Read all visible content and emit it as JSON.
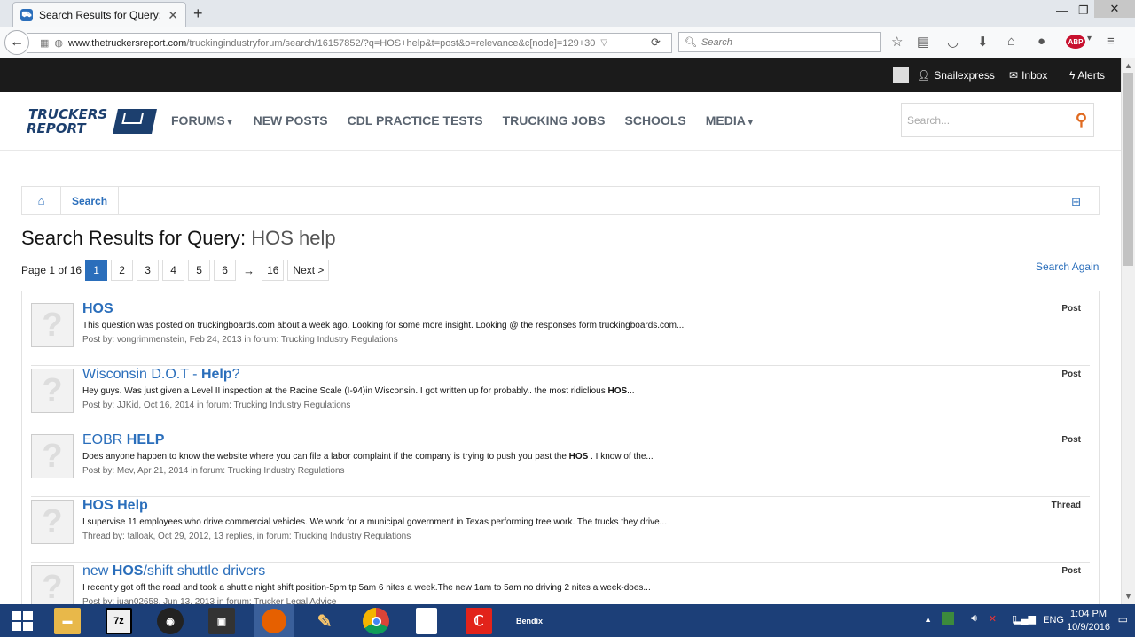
{
  "browser": {
    "tab_title": "Search Results for Query: ...",
    "url_host": "www.thetruckersreport.com",
    "url_path": "/truckingindustryforum/search/16157852/?q=HOS+help&t=post&o=relevance&c[node]=129+30",
    "search_placeholder": "Search",
    "abp_badge": "ABP"
  },
  "topbar": {
    "username": "Snailexpress",
    "inbox": "Inbox",
    "alerts": "Alerts"
  },
  "header": {
    "logo_line1": "TRUCKERS",
    "logo_line2": "REPORT",
    "nav": [
      "FORUMS",
      "NEW POSTS",
      "CDL PRACTICE TESTS",
      "TRUCKING JOBS",
      "SCHOOLS",
      "MEDIA"
    ],
    "search_placeholder": "Search..."
  },
  "breadcrumb": {
    "current": "Search"
  },
  "page": {
    "title_prefix": "Search Results for Query:",
    "query": "HOS help",
    "page_label": "Page 1 of 16",
    "pages": [
      "1",
      "2",
      "3",
      "4",
      "5",
      "6",
      "16"
    ],
    "arrow": "→",
    "next": "Next >",
    "search_again": "Search Again"
  },
  "results": [
    {
      "title_parts": [
        "HOS",
        ""
      ],
      "snippet": "This question was posted on truckingboards.com about a week ago. Looking for some more insight. Looking @ the responses form truckingboards.com...",
      "meta": "Post by: vongrimmenstein, Feb 24, 2013 in forum: Trucking Industry Regulations",
      "type": "Post"
    },
    {
      "title_parts": [
        "Wisconsin D.O.T - ",
        "Help",
        "?"
      ],
      "snippet_parts": [
        "Hey guys. Was just given a Level II inspection at the Racine Scale (I-94)in Wisconsin. I got written up for probably.. the most ridiclious ",
        "HOS",
        "..."
      ],
      "meta": "Post by: JJKid, Oct 16, 2014 in forum: Trucking Industry Regulations",
      "type": "Post"
    },
    {
      "title_parts": [
        "EOBR ",
        "HELP"
      ],
      "snippet_parts": [
        "Does anyone happen to know the website where you can file a labor complaint if the company is trying to push you past the ",
        "HOS",
        " . I know of the..."
      ],
      "meta": "Post by: Mev, Apr 21, 2014 in forum: Trucking Industry Regulations",
      "type": "Post"
    },
    {
      "title_parts": [
        "HOS Help"
      ],
      "snippet": "I supervise 11 employees who drive commercial vehicles. We work for a municipal government in Texas performing tree work. The trucks they drive...",
      "meta": "Thread by: talloak, Oct 29, 2012, 13 replies, in forum: Trucking Industry Regulations",
      "type": "Thread"
    },
    {
      "title_parts": [
        "new ",
        "HOS",
        "/shift shuttle drivers"
      ],
      "snippet": "I recently got off the road and took a shuttle night shift position-5pm tp 5am 6 nites a week.The new 1am to 5am no driving 2 nites a week-does...",
      "meta": "Post by: juan02658, Jun 13, 2013 in forum: Trucker Legal Advice",
      "type": "Post"
    }
  ],
  "taskbar": {
    "lang": "ENG",
    "time": "1:04 PM",
    "date": "10/9/2016",
    "app_7z": "7z",
    "app_bendix": "Bendix"
  },
  "colors": {
    "link": "#2a6ebb",
    "topbar": "#1b1b1b",
    "accent": "#e06a20",
    "taskbar": "#1c3f78"
  }
}
